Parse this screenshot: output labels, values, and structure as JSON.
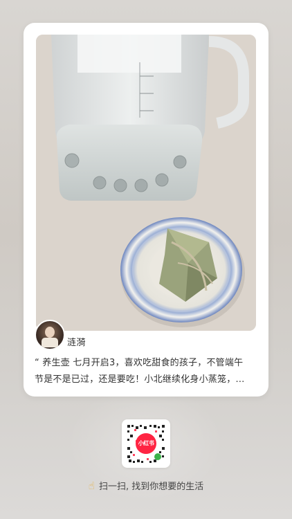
{
  "post": {
    "username": "涟漪",
    "description_line1": "“ 养生壶 七月开启3，喜欢吃甜食的孩子，不管端午",
    "description_line2": "节是不是已过，还是要吃！小北继续化身小蒸笼，…"
  },
  "qr_code": {
    "badge_text": "小红书"
  },
  "footer": {
    "hint_icon": "pointing-hand-icon",
    "hint_text": "扫一扫, 找到你想要的生活"
  },
  "colors": {
    "brand_red": "#ff2442",
    "hint_icon": "#e7b247"
  }
}
